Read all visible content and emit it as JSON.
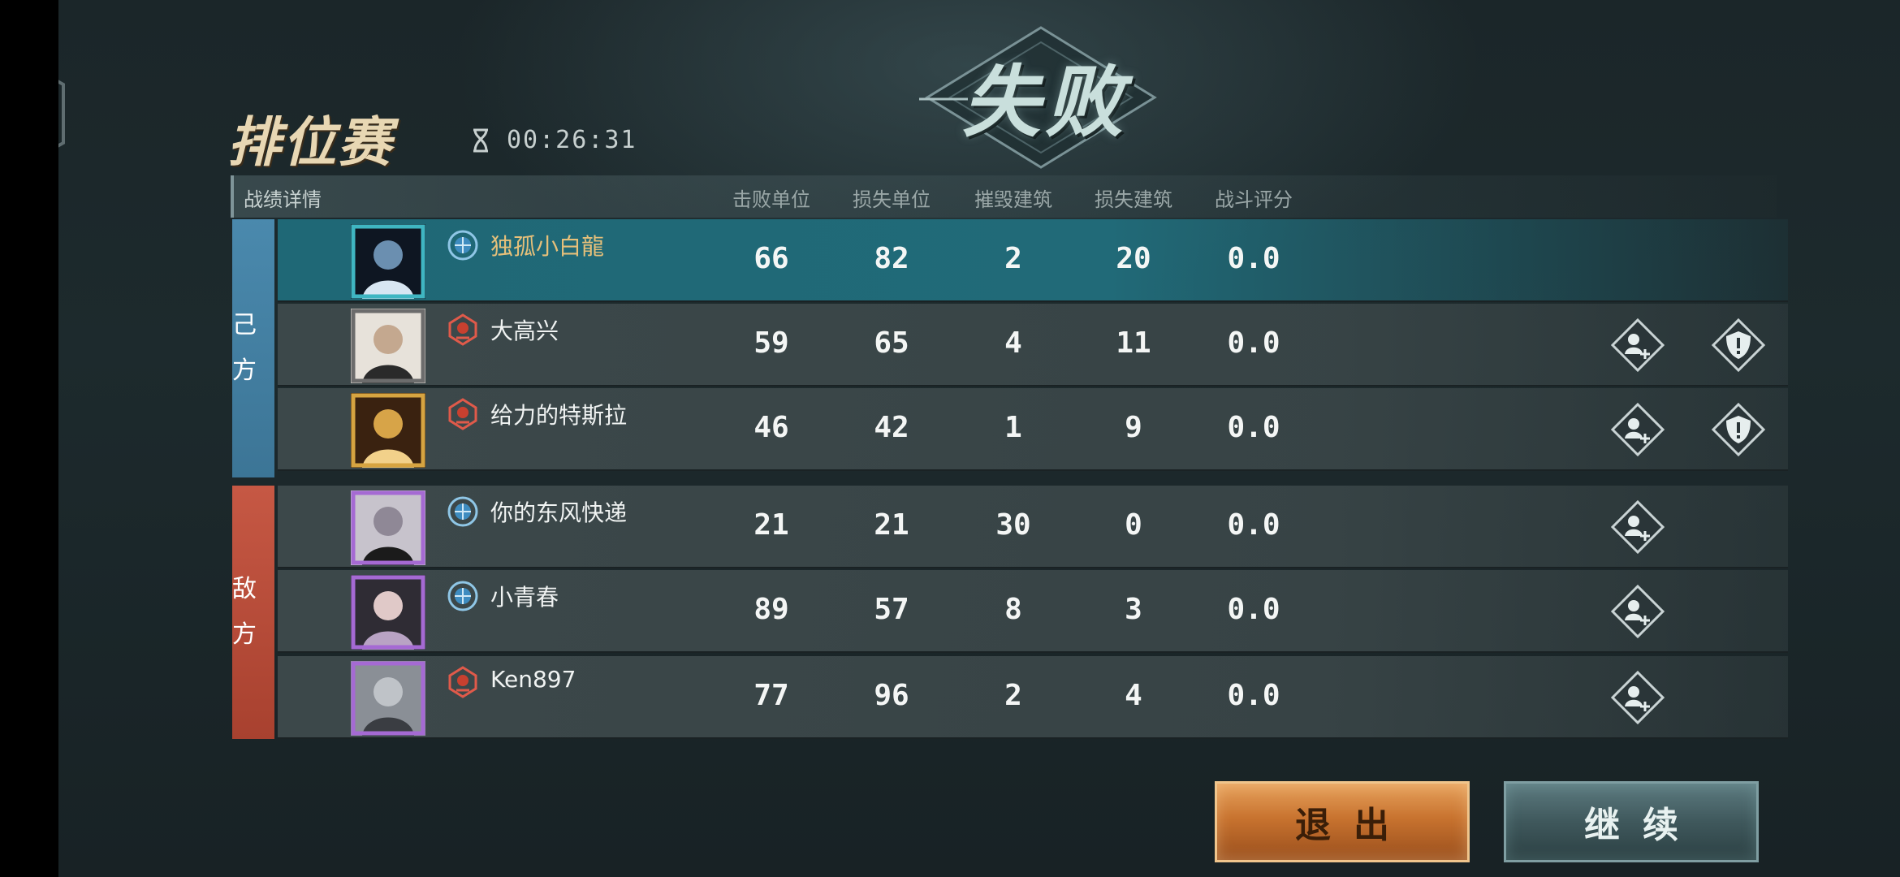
{
  "header": {
    "mode_title": "排位赛",
    "timer": "00:26:31",
    "result": "失败"
  },
  "table": {
    "section_label": "战绩详情",
    "columns": [
      "击败单位",
      "损失单位",
      "摧毁建筑",
      "损失建筑",
      "战斗评分"
    ]
  },
  "teams": {
    "own_label": "己方",
    "enemy_label": "敌方"
  },
  "players": [
    {
      "name": "独孤小白龍",
      "team": "own",
      "rank_icon": "blue-globe-rank-icon",
      "is_self": true,
      "stats": [
        "66",
        "82",
        "2",
        "20",
        "0.0"
      ],
      "actions": []
    },
    {
      "name": "大高兴",
      "team": "own",
      "rank_icon": "red-emblem-rank-icon",
      "is_self": false,
      "stats": [
        "59",
        "65",
        "4",
        "11",
        "0.0"
      ],
      "actions": [
        "add-friend-icon",
        "report-icon"
      ]
    },
    {
      "name": "给力的特斯拉",
      "team": "own",
      "rank_icon": "red-emblem-rank-icon",
      "is_self": false,
      "stats": [
        "46",
        "42",
        "1",
        "9",
        "0.0"
      ],
      "actions": [
        "add-friend-icon",
        "report-icon"
      ]
    },
    {
      "name": "你的东风快递",
      "team": "enemy",
      "rank_icon": "blue-globe-rank-icon",
      "is_self": false,
      "stats": [
        "21",
        "21",
        "30",
        "0",
        "0.0"
      ],
      "actions": [
        "add-friend-icon"
      ]
    },
    {
      "name": "小青春",
      "team": "enemy",
      "rank_icon": "blue-globe-rank-icon",
      "is_self": false,
      "stats": [
        "89",
        "57",
        "8",
        "3",
        "0.0"
      ],
      "actions": [
        "add-friend-icon"
      ]
    },
    {
      "name": "Ken897",
      "team": "enemy",
      "rank_icon": "red-emblem-rank-icon",
      "is_self": false,
      "stats": [
        "77",
        "96",
        "2",
        "4",
        "0.0"
      ],
      "actions": [
        "add-friend-icon"
      ]
    }
  ],
  "buttons": {
    "exit": "退出",
    "continue": "继续"
  },
  "colors": {
    "own_team": "#4a89ad",
    "enemy_team": "#c65844",
    "self_row": "#216a78",
    "self_name": "#e6c07a",
    "exit_button": "#c8732f"
  }
}
